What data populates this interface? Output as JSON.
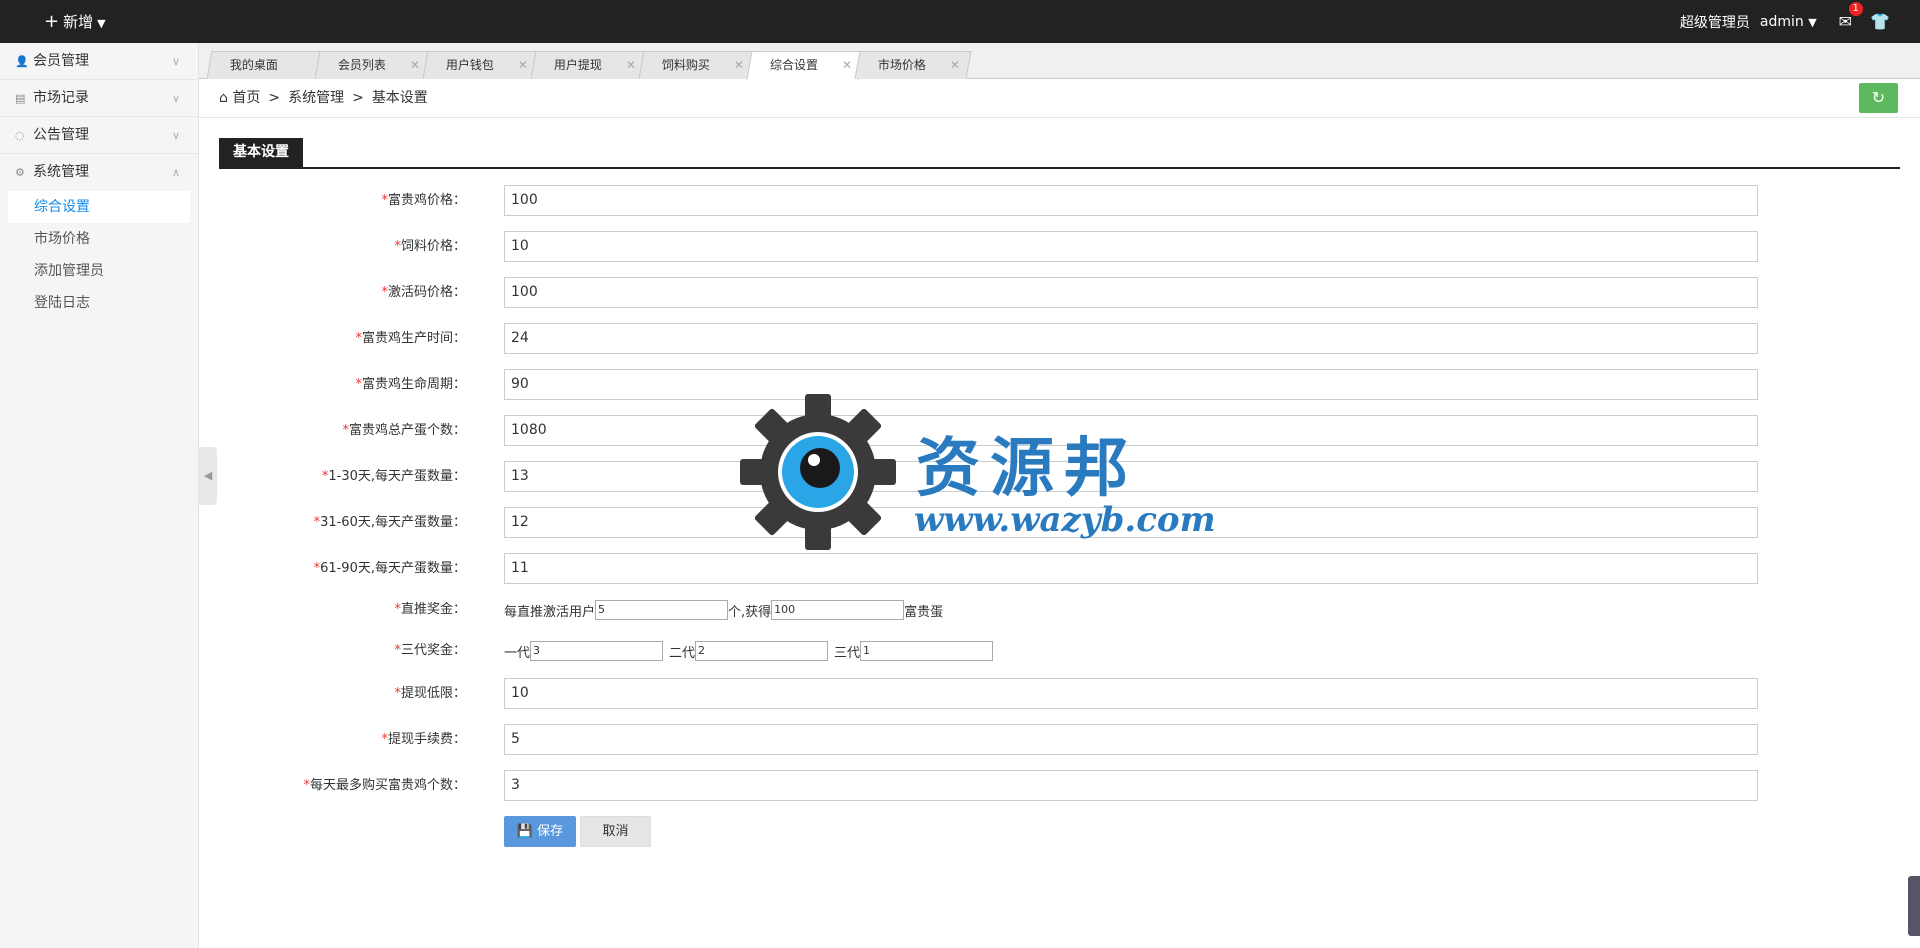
{
  "topbar": {
    "add_label": "新增",
    "user_role": "超级管理员",
    "username": "admin",
    "mail_count": "1"
  },
  "sidebar": {
    "menus": [
      {
        "label": "会员管理",
        "icon": "user-icon"
      },
      {
        "label": "市场记录",
        "icon": "record-icon"
      },
      {
        "label": "公告管理",
        "icon": "chat-icon"
      },
      {
        "label": "系统管理",
        "icon": "gear-icon"
      }
    ],
    "sub_items": [
      "综合设置",
      "市场价格",
      "添加管理员",
      "登陆日志"
    ]
  },
  "tabs": [
    {
      "label": "我的桌面"
    },
    {
      "label": "会员列表"
    },
    {
      "label": "用户钱包"
    },
    {
      "label": "用户提现"
    },
    {
      "label": "饲料购买"
    },
    {
      "label": "综合设置"
    },
    {
      "label": "市场价格"
    }
  ],
  "breadcrumb": {
    "home": "首页",
    "sep": ">",
    "level1": "系统管理",
    "level2": "基本设置"
  },
  "section": {
    "title": "基本设置"
  },
  "form": {
    "star": "*",
    "fields": [
      {
        "label": "富贵鸡价格：",
        "value": "100"
      },
      {
        "label": "饲料价格：",
        "value": "10"
      },
      {
        "label": "激活码价格：",
        "value": "100"
      },
      {
        "label": "富贵鸡生产时间：",
        "value": "24"
      },
      {
        "label": "富贵鸡生命周期：",
        "value": "90"
      },
      {
        "label": "富贵鸡总产蛋个数：",
        "value": "1080"
      },
      {
        "label": "1-30天,每天产蛋数量：",
        "value": "13"
      },
      {
        "label": "31-60天,每天产蛋数量：",
        "value": "12"
      },
      {
        "label": "61-90天,每天产蛋数量：",
        "value": "11"
      }
    ],
    "direct_bonus": {
      "label": "直推奖金：",
      "prefix": "每直推激活用户",
      "users": "5",
      "mid": "个,获得",
      "eggs": "100",
      "suffix": "富贵蛋"
    },
    "three_gen": {
      "label": "三代奖金：",
      "g1_label": "一代",
      "g1": "3",
      "g2_label": "二代",
      "g2": "2",
      "g3_label": "三代",
      "g3": "1"
    },
    "fields2": [
      {
        "label": "提现低限：",
        "value": "10"
      },
      {
        "label": "提现手续费：",
        "value": "5"
      },
      {
        "label": "每天最多购买富贵鸡个数：",
        "value": "3"
      }
    ],
    "save_label": "保存",
    "cancel_label": "取消"
  },
  "watermark": {
    "name": "资源邦",
    "url": "www.wazyb.com"
  }
}
